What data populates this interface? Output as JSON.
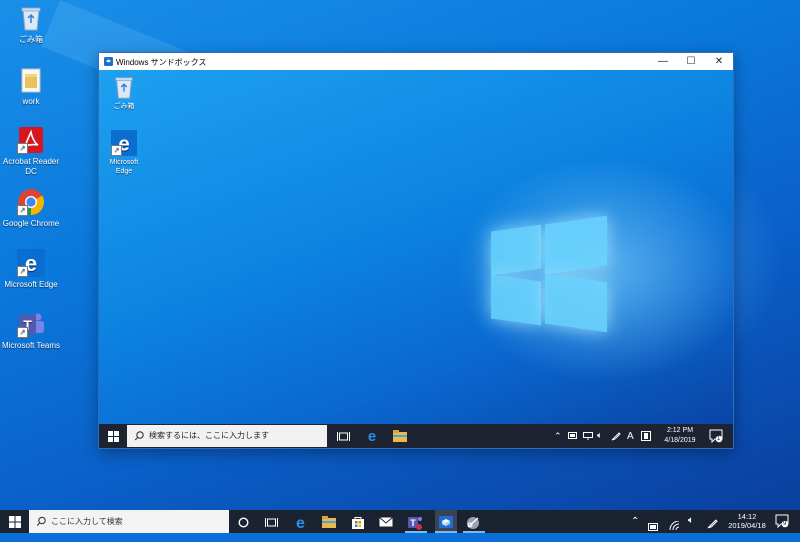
{
  "desktop": {
    "icons": [
      {
        "label": "ごみ箱",
        "icon": "recycle-bin-icon"
      },
      {
        "label": "work",
        "icon": "folder-icon"
      },
      {
        "label": "Acrobat Reader DC",
        "icon": "acrobat-reader-icon"
      },
      {
        "label": "Google Chrome",
        "icon": "chrome-icon"
      },
      {
        "label": "Microsoft Edge",
        "icon": "edge-icon"
      },
      {
        "label": "Microsoft Teams",
        "icon": "teams-icon"
      }
    ]
  },
  "sandbox": {
    "title": "Windows サンドボックス",
    "minimize": "—",
    "maximize": "☐",
    "close": "✕",
    "icons": [
      {
        "label": "ごみ箱",
        "icon": "recycle-bin-icon"
      },
      {
        "label": "Microsoft\nEdge",
        "label_line1": "Microsoft",
        "label_line2": "Edge",
        "icon": "edge-icon"
      }
    ],
    "taskbar": {
      "search_placeholder": "検索するには、ここに入力します",
      "ime": "A",
      "time": "2:12 PM",
      "date": "4/18/2019",
      "notification_count": "1"
    }
  },
  "taskbar": {
    "search_placeholder": "ここに入力して検索",
    "time": "14:12",
    "date": "2019/04/18",
    "notification_count": "9"
  },
  "colors": {
    "accent": "#0078d7",
    "taskbar": "#1b2230",
    "teams": "#5558af",
    "acrobat": "#d7171f"
  }
}
